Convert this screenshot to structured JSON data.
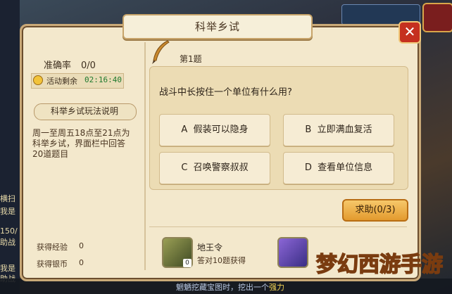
{
  "window": {
    "title": "科举乡试"
  },
  "left_panel": {
    "accuracy_label": "准确率",
    "accuracy_value": "0/0",
    "timer_label": "活动剩余",
    "timer_value": "02:16:40",
    "rules_button": "科举乡试玩法说明",
    "description": "周一至周五18点至21点为科举乡试，界面栏中回答20道题目",
    "reward_exp_label": "获得经验",
    "reward_exp_value": "0",
    "reward_silver_label": "获得银币",
    "reward_silver_value": "0"
  },
  "question": {
    "number_label": "第1题",
    "text": "战斗中长按住一个单位有什么用?",
    "options": [
      {
        "letter": "A",
        "text": "假装可以隐身"
      },
      {
        "letter": "B",
        "text": "立即满血复活"
      },
      {
        "letter": "C",
        "text": "召唤警察叔叔"
      },
      {
        "letter": "D",
        "text": "查看单位信息"
      }
    ],
    "help_button": "求助(0/3)"
  },
  "reward_item": {
    "name": "地王令",
    "count": "0",
    "condition": "答对10题获得"
  },
  "background": {
    "left_texts": [
      "横扫",
      "我是",
      "150/",
      "助战",
      "我是",
      "助战"
    ],
    "bottom_text_prefix": "魍魉挖藏宝图时，挖出一个",
    "bottom_text_highlight": "强力",
    "logo_text": "梦幻西游手游"
  },
  "icons": {
    "close": "close-icon",
    "clock": "clock-icon",
    "quill": "quill-icon",
    "item1": "scroll-item-icon",
    "item2": "blue-token-item-icon"
  },
  "colors": {
    "panel_bg": "#f3e8cc",
    "help_button": "#e8a23a",
    "close_button": "#c5301f",
    "timer_value": "#1f7a2f"
  }
}
